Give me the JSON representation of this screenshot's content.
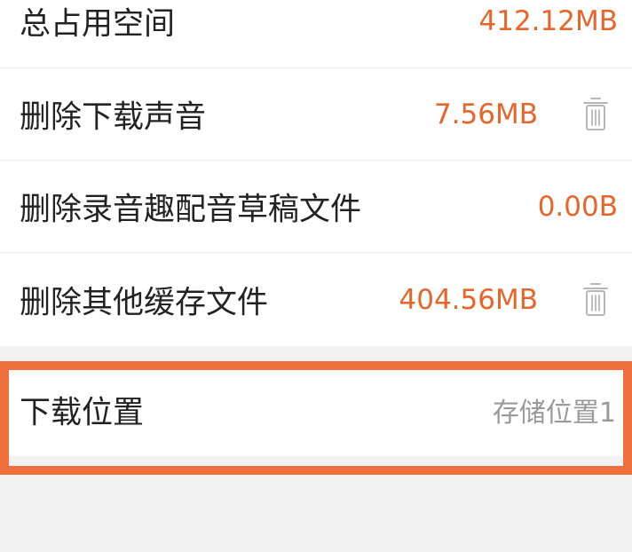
{
  "storage": {
    "total": {
      "label": "总占用空间",
      "value": "412.12MB"
    },
    "items": [
      {
        "label": "删除下载声音",
        "value": "7.56MB",
        "icon": "trash-icon"
      },
      {
        "label": "删除录音趣配音草稿文件",
        "value": "0.00B"
      },
      {
        "label": "删除其他缓存文件",
        "value": "404.56MB",
        "icon": "trash-icon"
      }
    ]
  },
  "download": {
    "label": "下载位置",
    "value": "存储位置1"
  },
  "colors": {
    "accent": "#e8652a",
    "highlight_border": "#f0703d",
    "secondary_text": "#9a9a9a",
    "background": "#f2f2f2"
  }
}
